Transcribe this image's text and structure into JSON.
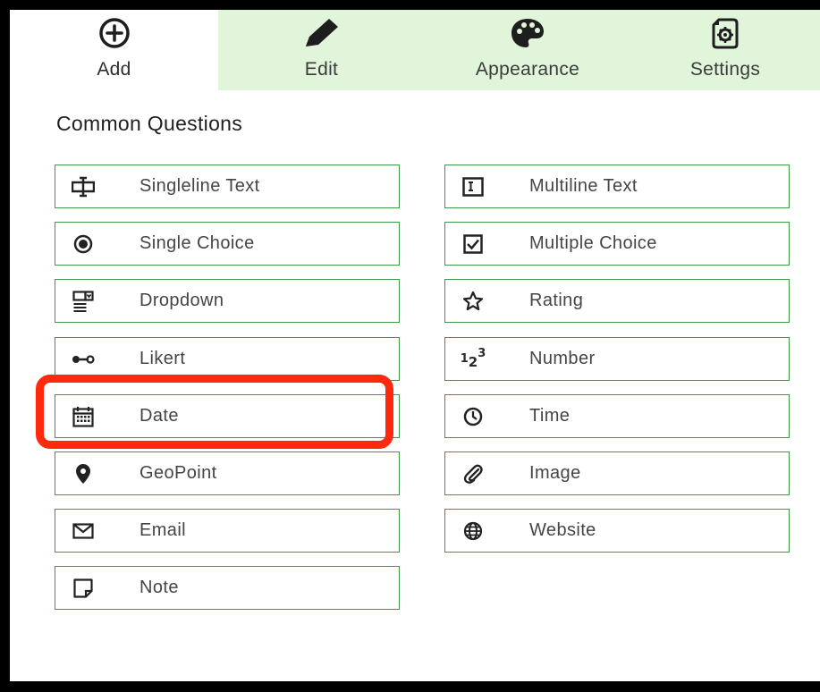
{
  "tabs": [
    {
      "label": "Add",
      "icon": "plus-circle-icon"
    },
    {
      "label": "Edit",
      "icon": "pencil-icon"
    },
    {
      "label": "Appearance",
      "icon": "palette-icon"
    },
    {
      "label": "Settings",
      "icon": "settings-document-icon"
    }
  ],
  "section_title": "Common Questions",
  "questions": [
    {
      "label": "Singleline Text",
      "icon": "singleline-text-icon"
    },
    {
      "label": "Multiline Text",
      "icon": "multiline-text-icon"
    },
    {
      "label": "Single Choice",
      "icon": "radio-icon"
    },
    {
      "label": "Multiple Choice",
      "icon": "checkbox-icon"
    },
    {
      "label": "Dropdown",
      "icon": "dropdown-icon"
    },
    {
      "label": "Rating",
      "icon": "star-icon"
    },
    {
      "label": "Likert",
      "icon": "slider-icon"
    },
    {
      "label": "Number",
      "icon": "number-icon",
      "icon_text": "123"
    },
    {
      "label": "Date",
      "icon": "calendar-icon",
      "highlighted": true
    },
    {
      "label": "Time",
      "icon": "clock-icon"
    },
    {
      "label": "GeoPoint",
      "icon": "map-pin-icon"
    },
    {
      "label": "Image",
      "icon": "paperclip-icon"
    },
    {
      "label": "Email",
      "icon": "envelope-icon"
    },
    {
      "label": "Website",
      "icon": "globe-icon"
    },
    {
      "label": "Note",
      "icon": "note-icon"
    }
  ],
  "colors": {
    "accent_border": "#3d9a45",
    "tab_inactive_bg": "#e0f5da",
    "highlight": "#ff2a0e"
  }
}
